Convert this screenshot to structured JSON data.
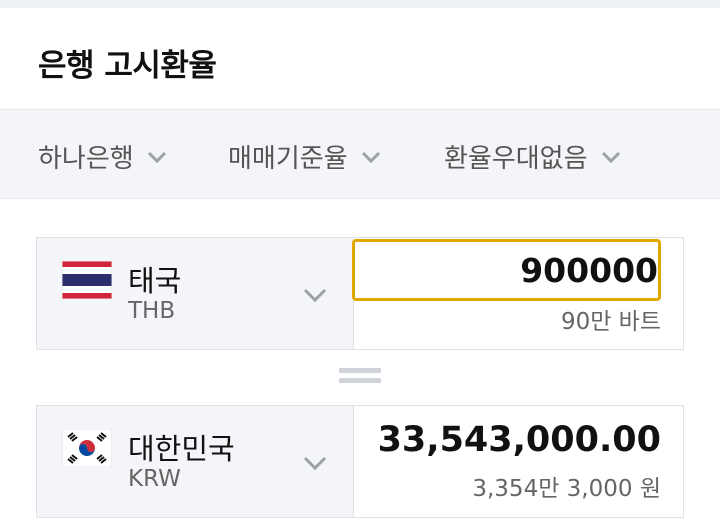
{
  "header": {
    "title": "은행 고시환율"
  },
  "filters": [
    {
      "label": "하나은행"
    },
    {
      "label": "매매기준율"
    },
    {
      "label": "환율우대없음"
    }
  ],
  "from": {
    "country": "태국",
    "code": "THB",
    "flag_icon": "thailand-flag-icon",
    "input_value": "900000",
    "sub_text": "90만 바트"
  },
  "to": {
    "country": "대한민국",
    "code": "KRW",
    "flag_icon": "korea-flag-icon",
    "value": "33,543,000.00",
    "sub_text": "3,354만 3,000 원"
  },
  "colors": {
    "accent_border": "#e0a800",
    "panel_bg": "#f3f5f8"
  }
}
